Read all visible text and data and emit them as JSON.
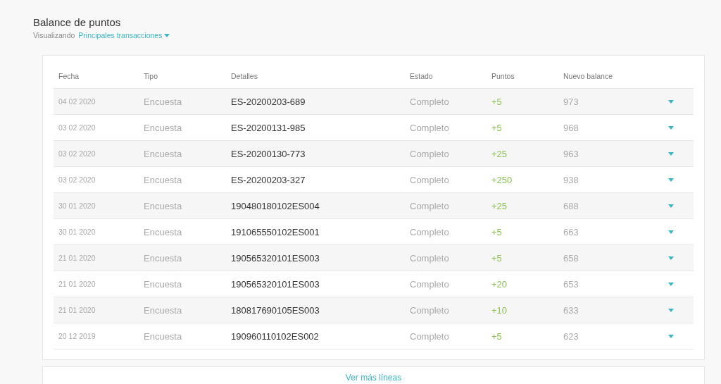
{
  "title": "Balance de puntos",
  "view": {
    "label": "Visualizando",
    "value": "Principales transacciones"
  },
  "table": {
    "columns": [
      "Fecha",
      "Tipo",
      "Detalles",
      "Estado",
      "Puntos",
      "Nuevo balance"
    ],
    "rows": [
      {
        "date": "04 02 2020",
        "type": "Encuesta",
        "details": "ES-20200203-689",
        "status": "Completo",
        "points": "+5",
        "balance": "973"
      },
      {
        "date": "03 02 2020",
        "type": "Encuesta",
        "details": "ES-20200131-985",
        "status": "Completo",
        "points": "+5",
        "balance": "968"
      },
      {
        "date": "03 02 2020",
        "type": "Encuesta",
        "details": "ES-20200130-773",
        "status": "Completo",
        "points": "+25",
        "balance": "963"
      },
      {
        "date": "03 02 2020",
        "type": "Encuesta",
        "details": "ES-20200203-327",
        "status": "Completo",
        "points": "+250",
        "balance": "938"
      },
      {
        "date": "30 01 2020",
        "type": "Encuesta",
        "details": "190480180102ES004",
        "status": "Completo",
        "points": "+25",
        "balance": "688"
      },
      {
        "date": "30 01 2020",
        "type": "Encuesta",
        "details": "191065550102ES001",
        "status": "Completo",
        "points": "+5",
        "balance": "663"
      },
      {
        "date": "21 01 2020",
        "type": "Encuesta",
        "details": "190565320101ES003",
        "status": "Completo",
        "points": "+5",
        "balance": "658"
      },
      {
        "date": "21 01 2020",
        "type": "Encuesta",
        "details": "190565320101ES003",
        "status": "Completo",
        "points": "+20",
        "balance": "653"
      },
      {
        "date": "21 01 2020",
        "type": "Encuesta",
        "details": "180817690105ES003",
        "status": "Completo",
        "points": "+10",
        "balance": "633"
      },
      {
        "date": "20 12 2019",
        "type": "Encuesta",
        "details": "190960110102ES002",
        "status": "Completo",
        "points": "+5",
        "balance": "623"
      }
    ]
  },
  "more": "Ver más líneas"
}
